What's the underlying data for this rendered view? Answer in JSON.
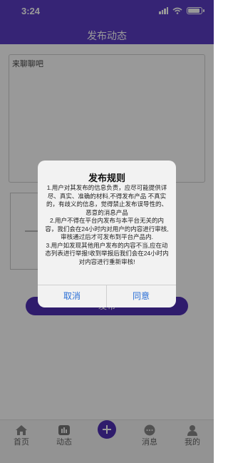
{
  "status_bar": {
    "time": "3:24"
  },
  "header": {
    "title": "发布动态"
  },
  "editor": {
    "placeholder": "来聊聊吧"
  },
  "publish_button": {
    "label": "发布"
  },
  "tabbar": {
    "items": [
      {
        "label": "首页",
        "icon": "home-icon"
      },
      {
        "label": "动态",
        "icon": "feed-icon"
      },
      {
        "label": "",
        "icon": "add-icon"
      },
      {
        "label": "消息",
        "icon": "message-icon"
      },
      {
        "label": "我的",
        "icon": "profile-icon"
      }
    ]
  },
  "dialog": {
    "title": "发布规则",
    "rules": [
      "1.用户对其发布的信息负责，应尽可能提供详尽、真实、准确的材料,不得发布产品 不真实的，有歧义的信息，觉得禁止发布误导性的、恶意的消息产品",
      "2.用户不得在平台内发布与本平台无关的内容，我们会在24小时内对用户的内容进行审核,审核通过后才可发布到平台产品内.",
      "3.用户如发现其他用户发布的内容不当,应在动态列表进行举报!收到举报后我们会在24小时内对内容进行重新审核!"
    ],
    "cancel_label": "取消",
    "confirm_label": "同意"
  },
  "colors": {
    "primary": "#5a3cc4",
    "button": "#4f2fb5",
    "link": "#2a6fd6"
  }
}
